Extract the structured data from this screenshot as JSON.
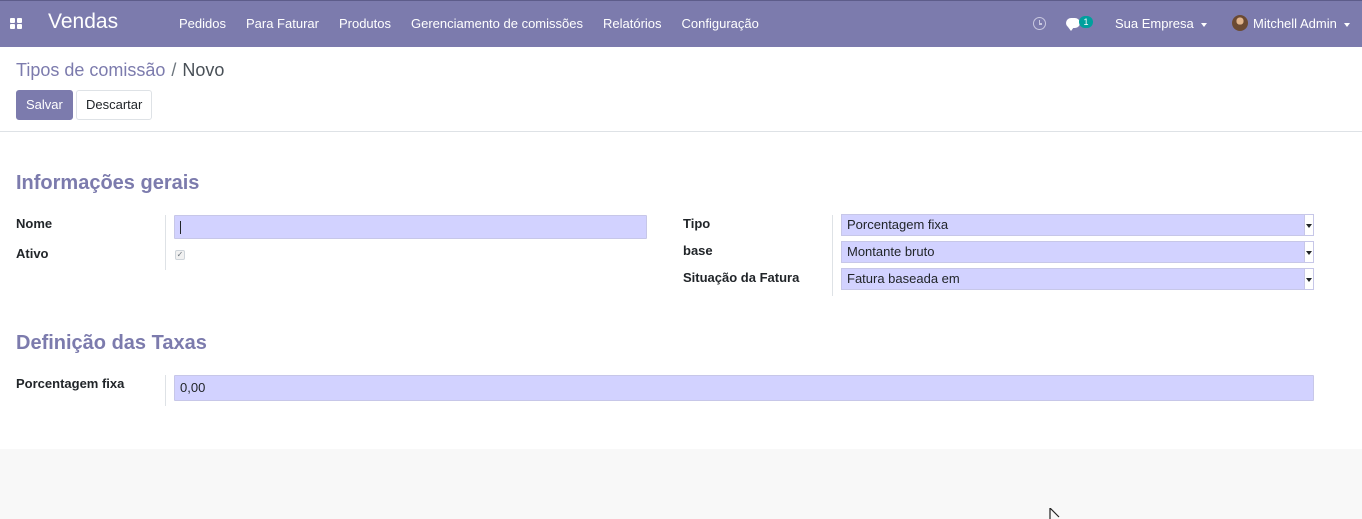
{
  "navbar": {
    "app_name": "Vendas",
    "menu": [
      "Pedidos",
      "Para Faturar",
      "Produtos",
      "Gerenciamento de comissões",
      "Relatórios",
      "Configuração"
    ],
    "chat_badge": "1",
    "company": "Sua Empresa",
    "user": "Mitchell Admin",
    "color": "#7c7bad"
  },
  "breadcrumb": {
    "parent": "Tipos de comissão",
    "separator": "/",
    "current": "Novo"
  },
  "buttons": {
    "save": "Salvar",
    "discard": "Descartar"
  },
  "form": {
    "general_section": "Informações gerais",
    "name_label": "Nome",
    "name_value": "",
    "active_label": "Ativo",
    "active_checked": true,
    "type_label": "Tipo",
    "type_value": "Porcentagem fixa",
    "base_label": "base",
    "base_value": "Montante bruto",
    "invoice_state_label": "Situação da Fatura",
    "invoice_state_value": "Fatura baseada em",
    "rates_section": "Definição das Taxas",
    "fixed_pct_label": "Porcentagem fixa",
    "fixed_pct_value": "0,00"
  }
}
